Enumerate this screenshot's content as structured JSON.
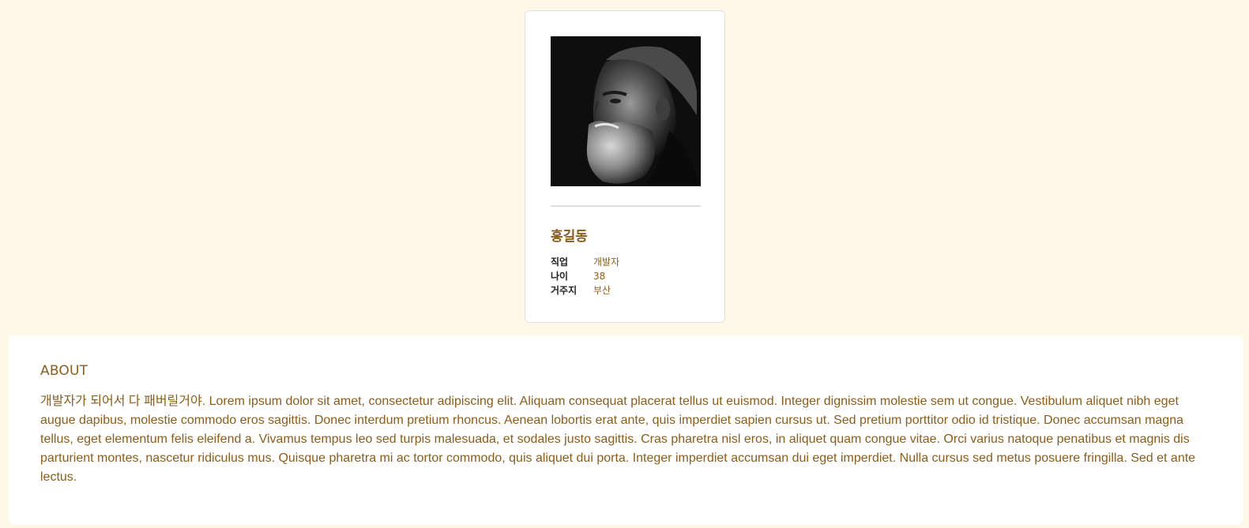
{
  "profile": {
    "name": "홍길동",
    "details": [
      {
        "label": "직업",
        "value": "개발자"
      },
      {
        "label": "나이",
        "value": "38"
      },
      {
        "label": "거주지",
        "value": "부산"
      }
    ]
  },
  "about": {
    "title": "ABOUT",
    "text": "개발자가 되어서 다 패버릴거야. Lorem ipsum dolor sit amet, consectetur adipiscing elit. Aliquam consequat placerat tellus ut euismod. Integer dignissim molestie sem ut congue. Vestibulum aliquet nibh eget augue dapibus, molestie commodo eros sagittis. Donec interdum pretium rhoncus. Aenean lobortis erat ante, quis imperdiet sapien cursus ut. Sed pretium porttitor odio id tristique. Donec accumsan magna tellus, eget elementum felis eleifend a. Vivamus tempus leo sed turpis malesuada, et sodales justo sagittis. Cras pharetra nisl eros, in aliquet quam congue vitae. Orci varius natoque penatibus et magnis dis parturient montes, nascetur ridiculus mus. Quisque pharetra mi ac tortor commodo, quis aliquet dui porta. Integer imperdiet accumsan dui eget imperdiet. Nulla cursus sed metus posuere fringilla. Sed et ante lectus."
  },
  "colors": {
    "page_background": "#fff8e9",
    "accent": "#8a5e1a",
    "card_background": "#ffffff"
  }
}
